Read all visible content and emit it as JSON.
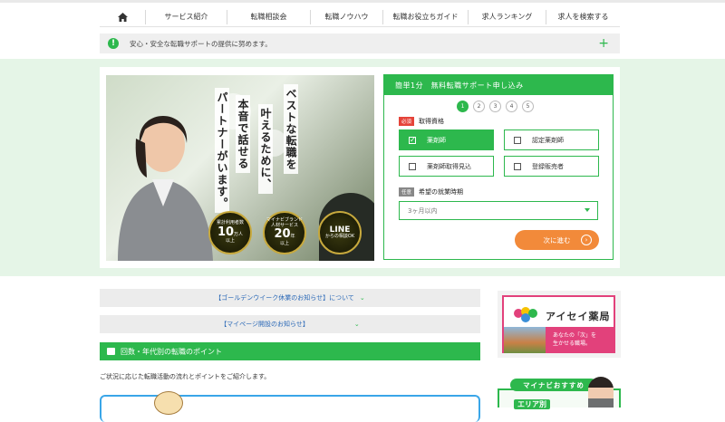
{
  "nav": {
    "home_icon": "home-icon",
    "items": [
      "サービス紹介",
      "転職相談会",
      "転職ノウハウ",
      "転職お役立ちガイド",
      "求人ランキング",
      "求人を検索する"
    ]
  },
  "notice": {
    "icon": "exclamation-icon",
    "text": "安心・安全な転職サポートの提供に努めます。",
    "expand": "+"
  },
  "hero": {
    "copy_lines": [
      "ベストな転職を",
      "叶えるために、",
      "本音で話せる",
      "パートナーがいます。"
    ],
    "badges": [
      {
        "top": "累計利用者数",
        "big": "10",
        "unit": "万人",
        "sub": "以上"
      },
      {
        "top": "マイナビブランド 人材サービス",
        "big": "20",
        "unit": "年",
        "sub": "以上"
      },
      {
        "top": "",
        "big": "LINE",
        "unit": "",
        "sub": "からの相談OK"
      }
    ]
  },
  "form": {
    "header": "簡単1分　無料転職サポート申し込み",
    "steps": [
      "1",
      "2",
      "3",
      "4",
      "5"
    ],
    "current_step": 1,
    "required_tag": "必須",
    "qualification_label": "取得資格",
    "options": [
      {
        "label": "薬剤師",
        "checked": true
      },
      {
        "label": "認定薬剤師",
        "checked": false
      },
      {
        "label": "薬剤師取得見込",
        "checked": false
      },
      {
        "label": "登録販売者",
        "checked": false
      }
    ],
    "optional_tag": "任意",
    "period_label": "希望の就業時期",
    "period_value": "3ヶ月以内",
    "next_button": "次に進む"
  },
  "accordions": [
    "【ゴールデンウイーク休業のお知らせ】について",
    "【マイページ開設のお知らせ】"
  ],
  "section": {
    "title": "回数・年代別の転職のポイント",
    "intro": "ご状況に応じた転職活動の流れとポイントをご紹介します。"
  },
  "sidebar": {
    "ad_name": "アイセイ薬局",
    "ad_copy_1": "あなたの「次」を",
    "ad_copy_2": "生かせる職場。",
    "recommend_title": "マイナビおすすめ",
    "area_label": "エリア別"
  },
  "colors": {
    "brand_green": "#2db84d",
    "accent_orange": "#f28a3a",
    "link_blue": "#2b69b7",
    "pink": "#e2417b"
  }
}
